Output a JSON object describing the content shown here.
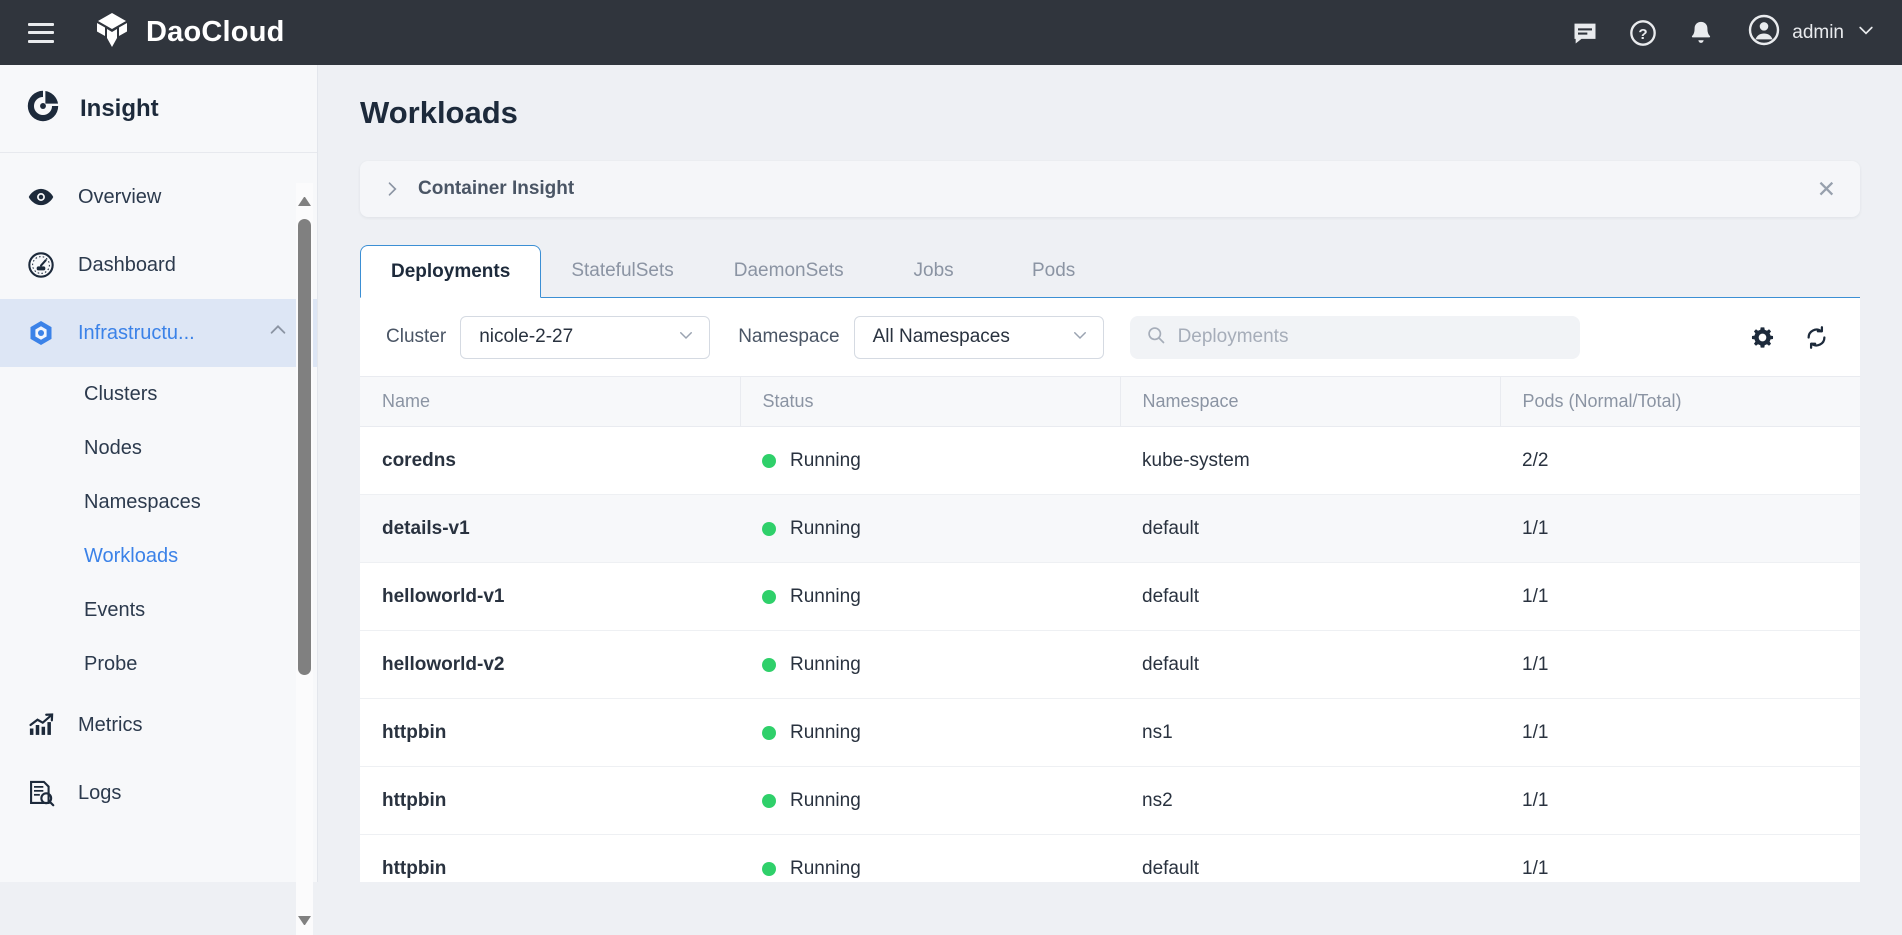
{
  "topbar": {
    "menu_icon": "hamburger-icon",
    "brand_name": "DaoCloud",
    "brand_icon": "daocloud-cube-logo",
    "icons": [
      {
        "name": "chat-icon"
      },
      {
        "name": "help-icon"
      },
      {
        "name": "notifications-bell-icon"
      }
    ],
    "user_name": "admin",
    "user_icon": "user-avatar-icon",
    "user_caret": "chevron-down-icon"
  },
  "sidebar": {
    "product_title": "Insight",
    "product_icon": "insight-donut-icon",
    "items": [
      {
        "label": "Overview",
        "icon": "eye-icon",
        "active": false,
        "type": "top"
      },
      {
        "label": "Dashboard",
        "icon": "gauge-icon",
        "active": false,
        "type": "top"
      },
      {
        "label": "Infrastructu...",
        "icon": "hexagon-cube-icon",
        "active": true,
        "type": "top",
        "chevron": "chevron-up-icon"
      },
      {
        "label": "Clusters",
        "type": "sub",
        "active": false
      },
      {
        "label": "Nodes",
        "type": "sub",
        "active": false
      },
      {
        "label": "Namespaces",
        "type": "sub",
        "active": false
      },
      {
        "label": "Workloads",
        "type": "sub",
        "active": true
      },
      {
        "label": "Events",
        "type": "sub",
        "active": false
      },
      {
        "label": "Probe",
        "type": "sub",
        "active": false
      },
      {
        "label": "Metrics",
        "icon": "trending-chart-icon",
        "active": false,
        "type": "top"
      },
      {
        "label": "Logs",
        "icon": "log-search-icon",
        "active": false,
        "type": "top"
      }
    ]
  },
  "main": {
    "page_title": "Workloads",
    "banner": {
      "chevron_icon": "chevron-right-icon",
      "text": "Container Insight",
      "close_icon": "close-icon"
    },
    "tabs": [
      {
        "label": "Deployments",
        "active": true
      },
      {
        "label": "StatefulSets",
        "active": false
      },
      {
        "label": "DaemonSets",
        "active": false
      },
      {
        "label": "Jobs",
        "active": false
      },
      {
        "label": "Pods",
        "active": false
      }
    ],
    "filters": {
      "cluster_label": "Cluster",
      "cluster_value": "nicole-2-27",
      "namespace_label": "Namespace",
      "namespace_value": "All Namespaces",
      "search_placeholder": "Deployments",
      "search_value": "",
      "search_icon": "search-icon",
      "settings_icon": "gear-icon",
      "refresh_icon": "refresh-icon"
    },
    "table": {
      "columns": [
        "Name",
        "Status",
        "Namespace",
        "Pods (Normal/Total)"
      ],
      "rows": [
        {
          "name": "coredns",
          "status": "Running",
          "namespace": "kube-system",
          "pods": "2/2"
        },
        {
          "name": "details-v1",
          "status": "Running",
          "namespace": "default",
          "pods": "1/1"
        },
        {
          "name": "helloworld-v1",
          "status": "Running",
          "namespace": "default",
          "pods": "1/1"
        },
        {
          "name": "helloworld-v2",
          "status": "Running",
          "namespace": "default",
          "pods": "1/1"
        },
        {
          "name": "httpbin",
          "status": "Running",
          "namespace": "ns1",
          "pods": "1/1"
        },
        {
          "name": "httpbin",
          "status": "Running",
          "namespace": "ns2",
          "pods": "1/1"
        },
        {
          "name": "httpbin",
          "status": "Running",
          "namespace": "default",
          "pods": "1/1"
        }
      ]
    }
  },
  "colors": {
    "topbar_bg": "#30353d",
    "accent_blue": "#3b82e8",
    "tab_border": "#3b8fd4",
    "status_green": "#2fd06a",
    "page_bg": "#eef0f4",
    "sidebar_bg": "#f7f8fa"
  }
}
